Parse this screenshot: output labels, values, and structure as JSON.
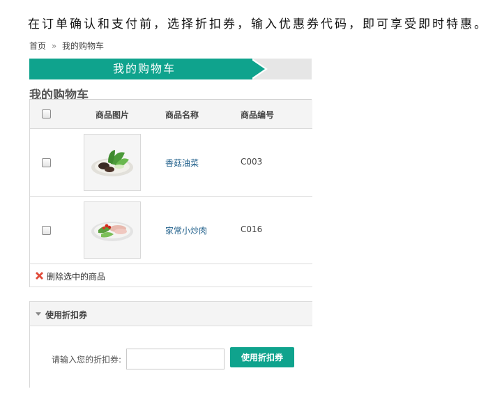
{
  "notice": "在订单确认和支付前，选择折扣券，输入优惠券代码，即可享受即时特惠。",
  "breadcrumb": {
    "home": "首页",
    "separator": "»",
    "current": "我的购物车"
  },
  "banner": {
    "title": "我的购物车"
  },
  "cart_heading": "我的购物车",
  "table": {
    "headers": {
      "image": "商品图片",
      "name": "商品名称",
      "code": "商品编号"
    },
    "rows": [
      {
        "name": "香菇油菜",
        "code": "C003",
        "image_icon": "mushroom-greens-dish"
      },
      {
        "name": "家常小炒肉",
        "code": "C016",
        "image_icon": "stir-fried-pork-dish"
      }
    ],
    "delete_selected": "删除选中的商品"
  },
  "coupon": {
    "title": "使用折扣券",
    "label": "请输入您的折扣券:",
    "input_value": "",
    "input_placeholder": "",
    "button": "使用折扣券"
  },
  "colors": {
    "accent": "#0fa38d",
    "link": "#1f5f8a",
    "delete_icon": "#e04b3a"
  }
}
